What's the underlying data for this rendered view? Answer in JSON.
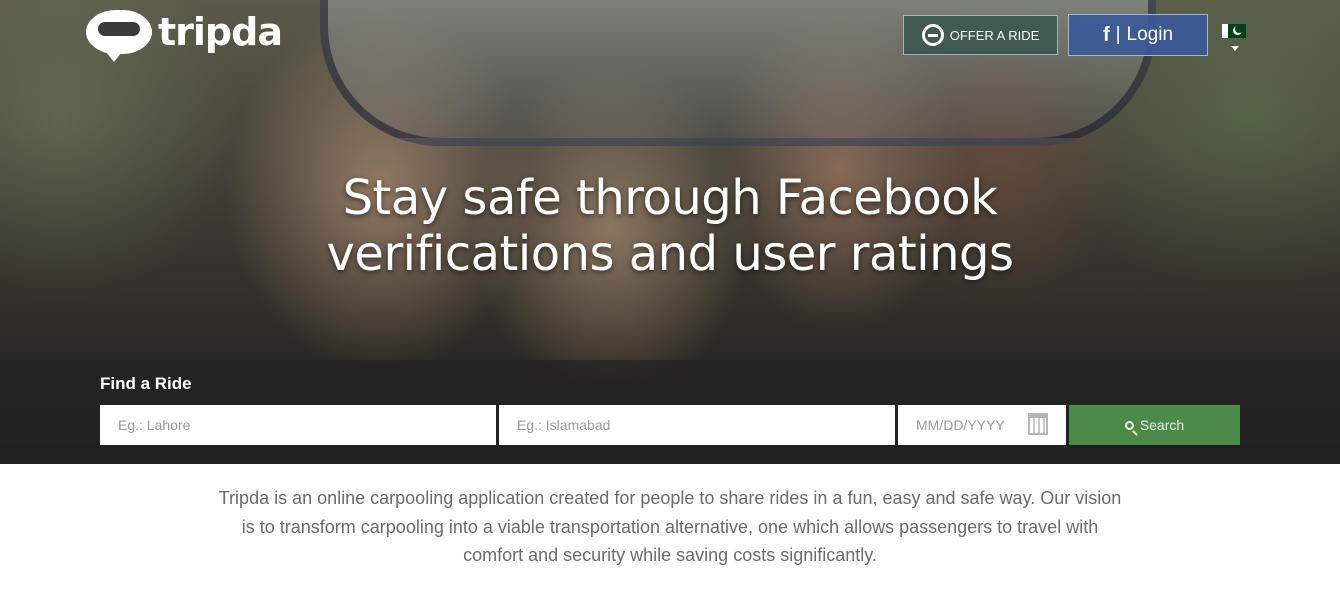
{
  "header": {
    "logo_text": "tripda",
    "offer_ride_label": "OFFER A RIDE",
    "login_icon": "f",
    "login_separator": "|",
    "login_label": "Login",
    "country_flag_icon": "pakistan-flag-icon"
  },
  "hero": {
    "headline": "Stay safe through Facebook verifications and user ratings"
  },
  "search": {
    "title": "Find a Ride",
    "from_placeholder": "Eg.: Lahore",
    "to_placeholder": "Eg.: Islamabad",
    "date_placeholder": "MM/DD/YYYY",
    "search_label": "Search"
  },
  "description": "Tripda is an online carpooling application created for people to share rides in a fun, easy and safe way. Our vision is to transform carpooling into a viable transportation alternative, one which allows passengers to travel with comfort and security while saving costs significantly.",
  "colors": {
    "search_button": "#4c8a4a",
    "facebook_blue": "#3b5998",
    "offer_button": "#3a564d"
  }
}
